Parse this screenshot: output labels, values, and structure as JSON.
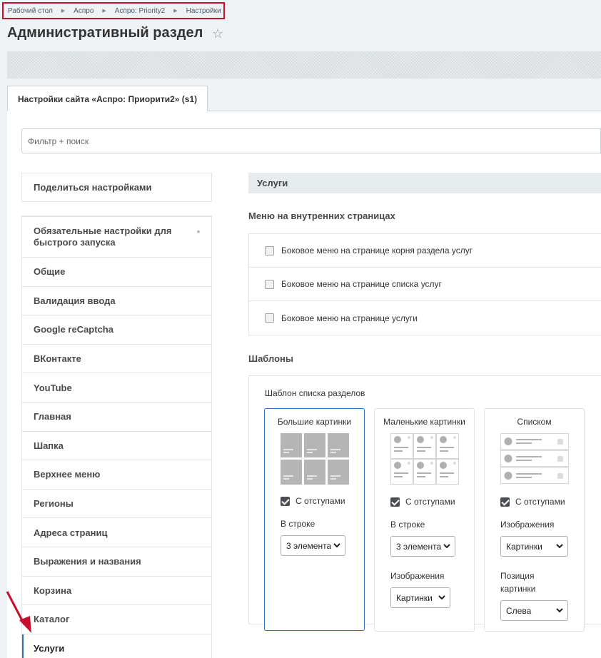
{
  "breadcrumb": [
    "Рабочий стол",
    "Аспро",
    "Аспро: Priority2",
    "Настройки"
  ],
  "page": {
    "title": "Административный раздел"
  },
  "tab": {
    "label": "Настройки сайта «Аспро: Приорити2» (s1)"
  },
  "filter": {
    "placeholder": "Фильтр + поиск"
  },
  "sidebar": {
    "share_label": "Поделиться настройками",
    "items": [
      "Обязательные настройки для быстрого запуска",
      "Общие",
      "Валидация ввода",
      "Google reCaptcha",
      "ВКонтакте",
      "YouTube",
      "Главная",
      "Шапка",
      "Верхнее меню",
      "Регионы",
      "Адреса страниц",
      "Выражения и названия",
      "Корзина",
      "Каталог",
      "Услуги"
    ],
    "required_mark": "*"
  },
  "main": {
    "section_title": "Услуги",
    "menu_heading": "Меню на внутренних страницах",
    "menu_options": [
      "Боковое меню на странице корня раздела услуг",
      "Боковое меню на странице списка услуг",
      "Боковое меню на странице услуги"
    ],
    "templates_heading": "Шаблоны",
    "template_list_label": "Шаблон списка разделов",
    "cards": [
      {
        "title": "Большие картинки",
        "check_label": "С отступами",
        "per_row_label": "В строке",
        "per_row_value": "3 элемента"
      },
      {
        "title": "Маленькие картинки",
        "check_label": "С отступами",
        "per_row_label": "В строке",
        "per_row_value": "3 элемента",
        "images_label": "Изображения",
        "images_value": "Картинки"
      },
      {
        "title": "Списком",
        "check_label": "С отступами",
        "images_label": "Изображения",
        "images_value": "Картинки",
        "position_label": "Позиция картинки",
        "position_value": "Слева"
      }
    ]
  },
  "colors": {
    "accent": "#2a6ebb",
    "highlight_border": "#c8102e",
    "arrow": "#c8102e"
  }
}
